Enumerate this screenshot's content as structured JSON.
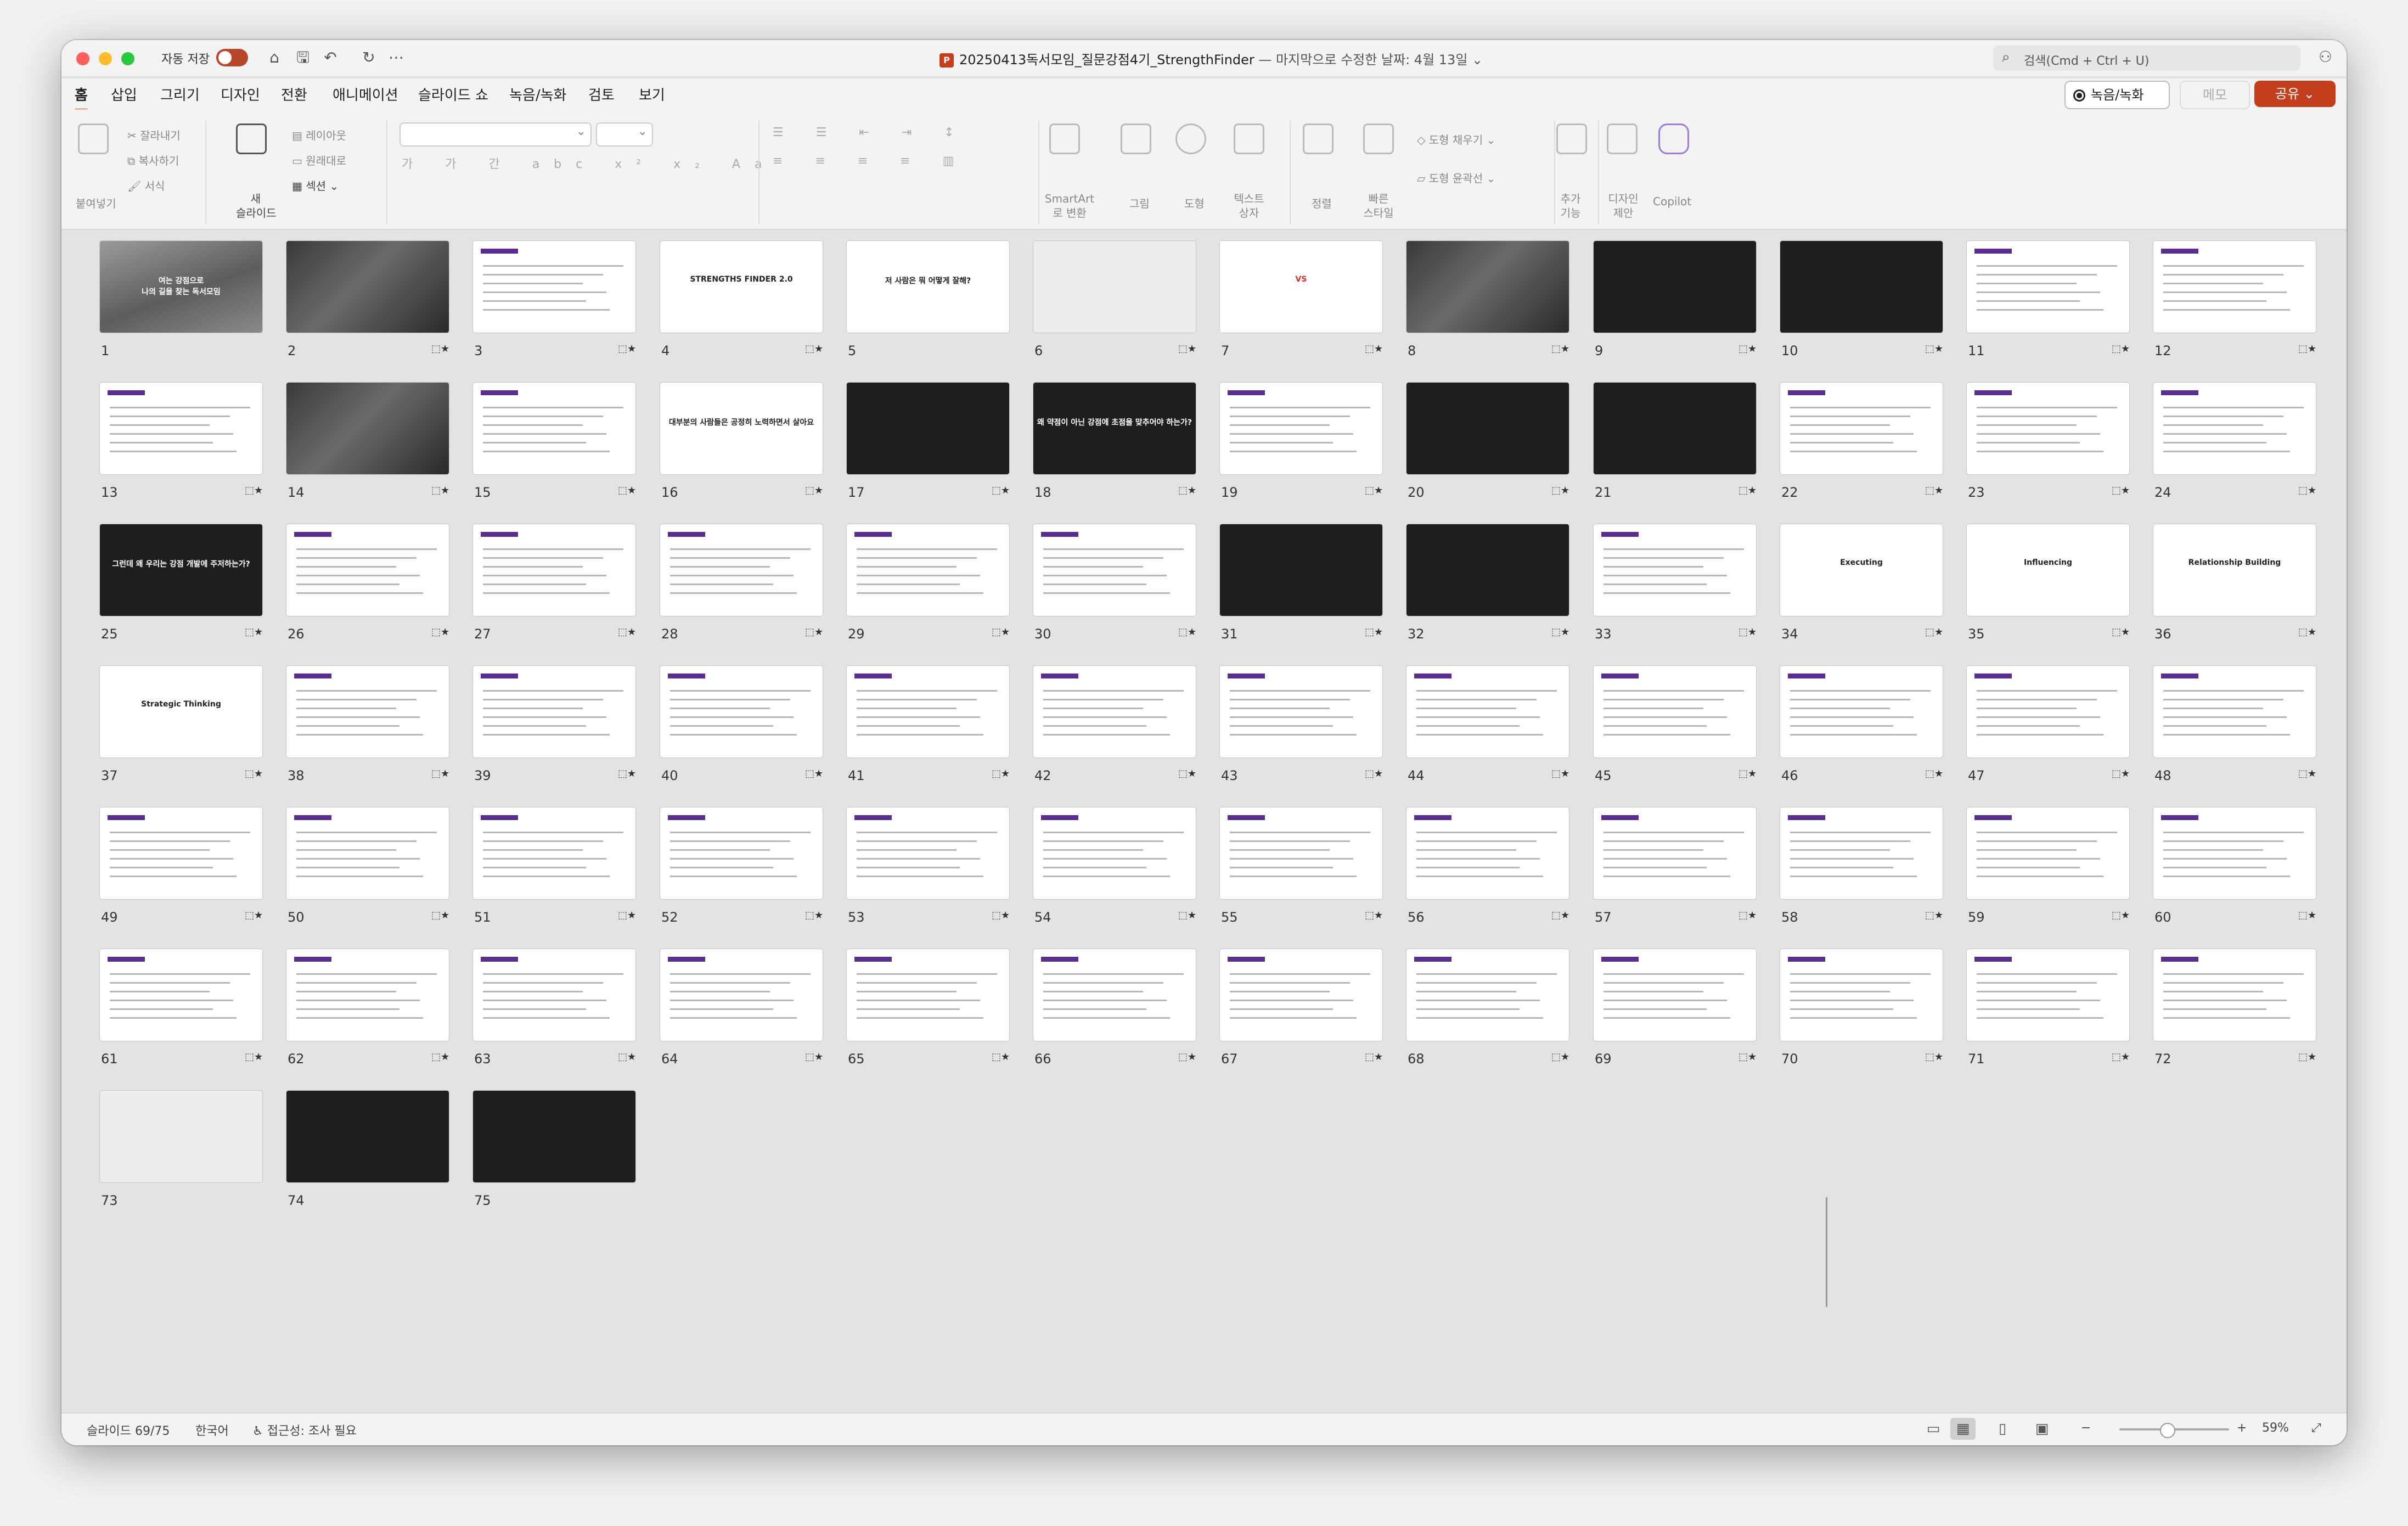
{
  "titlebar": {
    "autosave_label": "자동 저장",
    "doc_name": "20250413독서모임_질문강점4기_StrengthFinder",
    "doc_status": " — 마지막으로 수정한 날짜: 4월 13일",
    "search_placeholder": "검색(Cmd + Ctrl + U)"
  },
  "tabs": [
    "홈",
    "삽입",
    "그리기",
    "디자인",
    "전환",
    "애니메이션",
    "슬라이드 쇼",
    "녹음/녹화",
    "검토",
    "보기"
  ],
  "actions": {
    "record": "녹음/녹화",
    "memo": "메모",
    "share": "공유"
  },
  "ribbon": {
    "paste": "붙여넣기",
    "cut": "잘라내기",
    "copy": "복사하기",
    "format": "서식",
    "new_slide": "새\n슬라이드",
    "layout": "레이아웃",
    "reset": "원래대로",
    "section": "섹션",
    "smartart": "SmartArt\n로 변환",
    "picture": "그림",
    "shape": "도형",
    "textbox": "텍스트\n상자",
    "arrange": "정렬",
    "quick_styles": "빠른\n스타일",
    "shape_fill": "도형 채우기",
    "shape_outline": "도형 윤곽선",
    "addins": "추가\n기능",
    "designer": "디자인\n제안",
    "copilot": "Copilot",
    "font_glyphs": "가 가 간 abc x² x₂ Aa",
    "para_glyphs": "≡ ≡ ≡ ≡ ▥"
  },
  "slides": {
    "total": 75,
    "selected": 69,
    "items": [
      {
        "n": "1",
        "c": "여는 강점으로\n나의 길을 찾는 독서모임",
        "t": "photo"
      },
      {
        "n": "2",
        "c": "",
        "t": "photo2"
      },
      {
        "n": "3",
        "c": "",
        "t": "white"
      },
      {
        "n": "4",
        "c": "STRENGTHS FINDER 2.0",
        "t": "white"
      },
      {
        "n": "5",
        "c": "저 사람은 뭐 어떻게 잘해?",
        "t": "white"
      },
      {
        "n": "6",
        "c": "",
        "t": "gray"
      },
      {
        "n": "7",
        "c": "VS",
        "t": "white"
      },
      {
        "n": "8",
        "c": "",
        "t": "photo2"
      },
      {
        "n": "9",
        "c": "",
        "t": "dark"
      },
      {
        "n": "10",
        "c": "",
        "t": "dark"
      },
      {
        "n": "11",
        "c": "",
        "t": "white"
      },
      {
        "n": "12",
        "c": "",
        "t": "white"
      },
      {
        "n": "13",
        "c": "",
        "t": "white"
      },
      {
        "n": "14",
        "c": "",
        "t": "photo2"
      },
      {
        "n": "15",
        "c": "",
        "t": "white"
      },
      {
        "n": "16",
        "c": "대부분의 사람들은 공정히 노력하면서 살아요",
        "t": "white"
      },
      {
        "n": "17",
        "c": "",
        "t": "dark"
      },
      {
        "n": "18",
        "c": "왜 약점이 아닌 강점에 초점을 맞추어야 하는가?",
        "t": "dark"
      },
      {
        "n": "19",
        "c": "",
        "t": "white"
      },
      {
        "n": "20",
        "c": "",
        "t": "dark"
      },
      {
        "n": "21",
        "c": "",
        "t": "dark"
      },
      {
        "n": "22",
        "c": "",
        "t": "white"
      },
      {
        "n": "23",
        "c": "",
        "t": "white"
      },
      {
        "n": "24",
        "c": "",
        "t": "white"
      },
      {
        "n": "25",
        "c": "그런데 왜 우리는 강점 개발에 주저하는가?",
        "t": "dark"
      },
      {
        "n": "26",
        "c": "",
        "t": "white"
      },
      {
        "n": "27",
        "c": "",
        "t": "white"
      },
      {
        "n": "28",
        "c": "",
        "t": "white"
      },
      {
        "n": "29",
        "c": "",
        "t": "white"
      },
      {
        "n": "30",
        "c": "",
        "t": "white"
      },
      {
        "n": "31",
        "c": "",
        "t": "dark"
      },
      {
        "n": "32",
        "c": "",
        "t": "dark"
      },
      {
        "n": "33",
        "c": "",
        "t": "white"
      },
      {
        "n": "34",
        "c": "Executing",
        "t": "white"
      },
      {
        "n": "35",
        "c": "Influencing",
        "t": "white"
      },
      {
        "n": "36",
        "c": "Relationship Building",
        "t": "white"
      },
      {
        "n": "37",
        "c": "Strategic Thinking",
        "t": "white"
      },
      {
        "n": "38",
        "c": "",
        "t": "white"
      },
      {
        "n": "39",
        "c": "",
        "t": "white"
      },
      {
        "n": "40",
        "c": "",
        "t": "white"
      },
      {
        "n": "41",
        "c": "",
        "t": "white"
      },
      {
        "n": "42",
        "c": "",
        "t": "white"
      },
      {
        "n": "43",
        "c": "",
        "t": "white"
      },
      {
        "n": "44",
        "c": "",
        "t": "white"
      },
      {
        "n": "45",
        "c": "",
        "t": "white"
      },
      {
        "n": "46",
        "c": "",
        "t": "white"
      },
      {
        "n": "47",
        "c": "",
        "t": "white"
      },
      {
        "n": "48",
        "c": "",
        "t": "white"
      },
      {
        "n": "49",
        "c": "",
        "t": "white"
      },
      {
        "n": "50",
        "c": "",
        "t": "white"
      },
      {
        "n": "51",
        "c": "",
        "t": "white"
      },
      {
        "n": "52",
        "c": "",
        "t": "white"
      },
      {
        "n": "53",
        "c": "",
        "t": "white"
      },
      {
        "n": "54",
        "c": "",
        "t": "white"
      },
      {
        "n": "55",
        "c": "",
        "t": "white"
      },
      {
        "n": "56",
        "c": "",
        "t": "white"
      },
      {
        "n": "57",
        "c": "",
        "t": "white"
      },
      {
        "n": "58",
        "c": "",
        "t": "white"
      },
      {
        "n": "59",
        "c": "",
        "t": "white"
      },
      {
        "n": "60",
        "c": "",
        "t": "white"
      },
      {
        "n": "61",
        "c": "",
        "t": "white"
      },
      {
        "n": "62",
        "c": "",
        "t": "white"
      },
      {
        "n": "63",
        "c": "",
        "t": "white"
      },
      {
        "n": "64",
        "c": "",
        "t": "white"
      },
      {
        "n": "65",
        "c": "",
        "t": "white"
      },
      {
        "n": "66",
        "c": "",
        "t": "white"
      },
      {
        "n": "67",
        "c": "",
        "t": "white"
      },
      {
        "n": "68",
        "c": "",
        "t": "white"
      },
      {
        "n": "69",
        "c": "",
        "t": "white"
      },
      {
        "n": "70",
        "c": "",
        "t": "white"
      },
      {
        "n": "71",
        "c": "",
        "t": "white"
      },
      {
        "n": "72",
        "c": "",
        "t": "white"
      },
      {
        "n": "73",
        "c": "",
        "t": "gray"
      },
      {
        "n": "74",
        "c": "",
        "t": "dark"
      },
      {
        "n": "75",
        "c": "",
        "t": "dark"
      }
    ]
  },
  "status": {
    "slide_indicator": "슬라이드 69/75",
    "language": "한국어",
    "accessibility": "접근성: 조사 필요",
    "zoom": "59%"
  },
  "colors": {
    "accent": "#c43e1c",
    "purple": "#5a2d91",
    "canvas": "#e3e3e3"
  }
}
